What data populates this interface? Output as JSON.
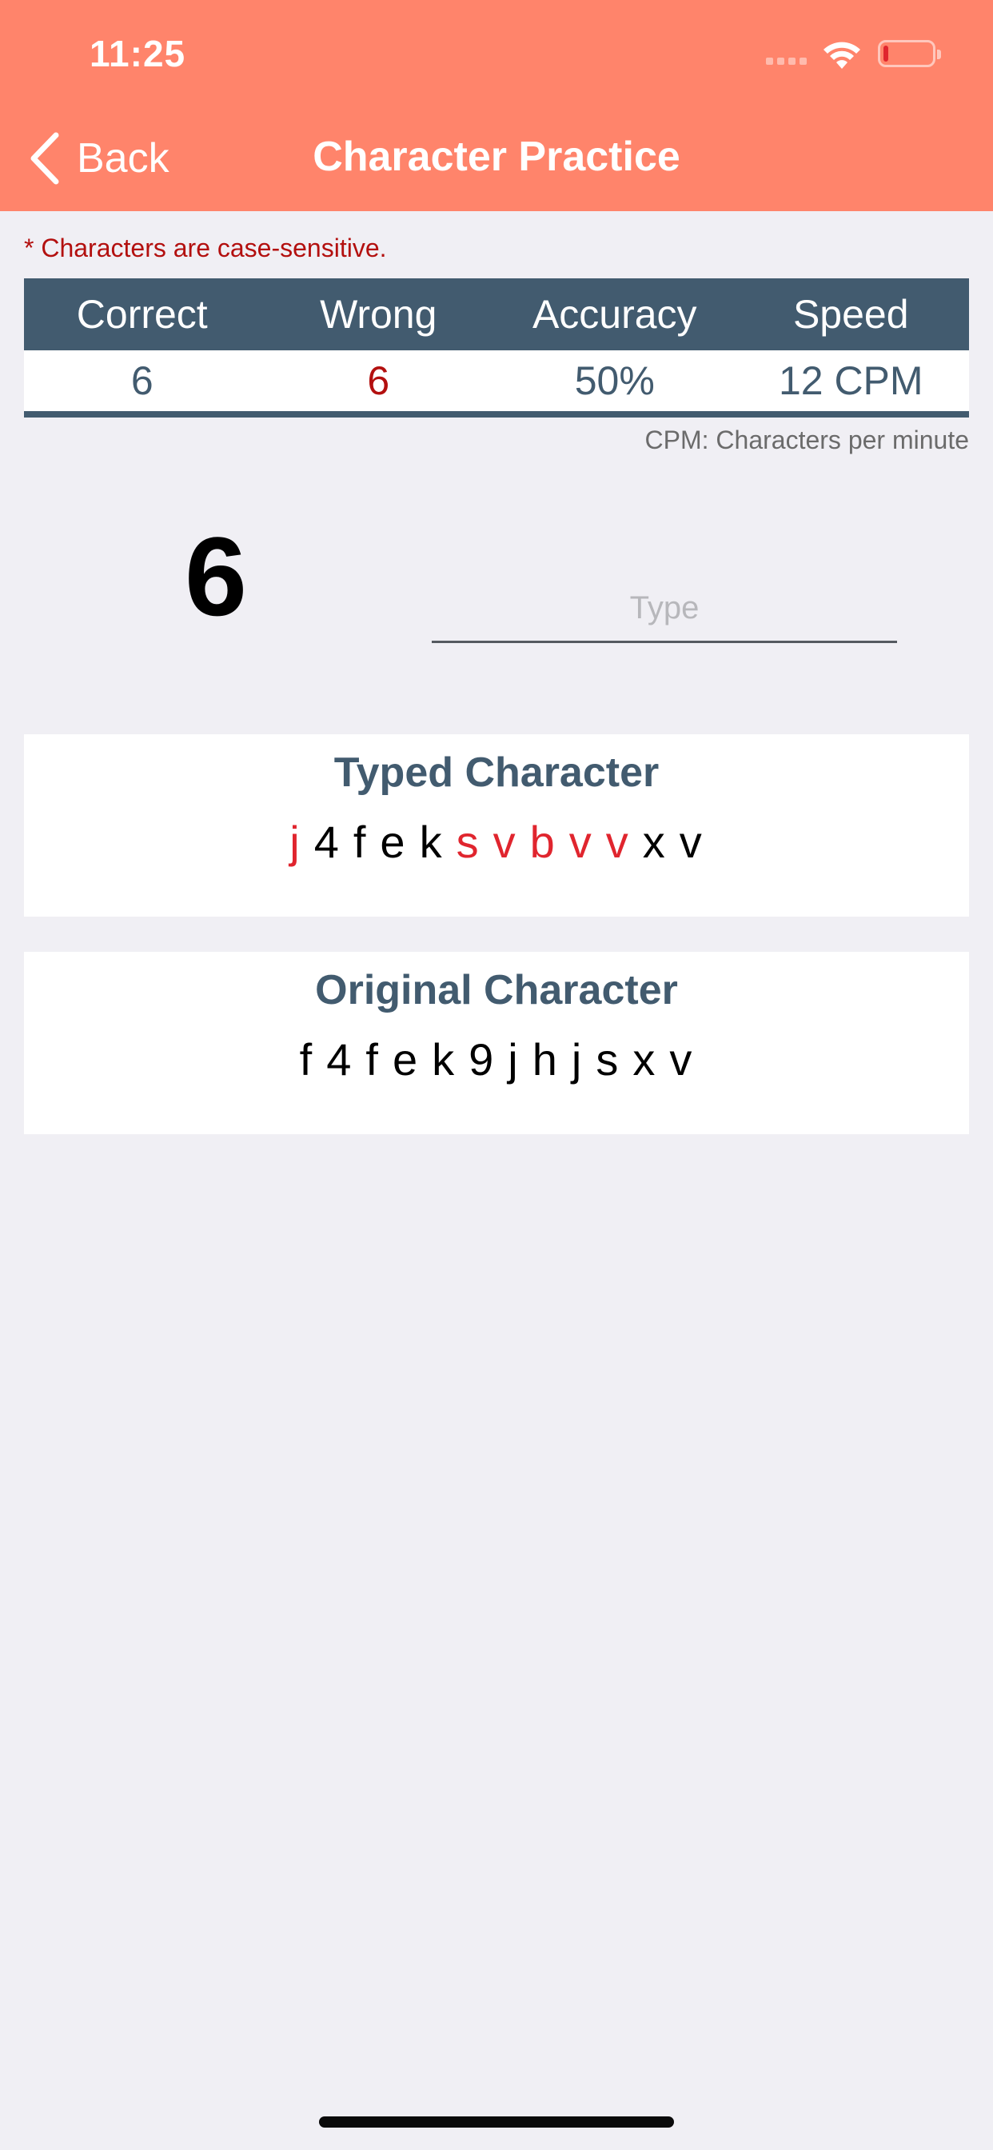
{
  "status_bar": {
    "time": "11:25"
  },
  "nav": {
    "back_label": "Back",
    "title": "Character Practice"
  },
  "notice": "* Characters are case-sensitive.",
  "stats": {
    "headers": [
      "Correct",
      "Wrong",
      "Accuracy",
      "Speed"
    ],
    "values": [
      "6",
      "6",
      "50%",
      "12 CPM"
    ]
  },
  "cpm_note": "CPM: Characters per minute",
  "current_character": "6",
  "input": {
    "placeholder": "Type",
    "value": ""
  },
  "typed": {
    "title": "Typed Character",
    "chars": [
      {
        "c": "j",
        "correct": false
      },
      {
        "c": "4",
        "correct": true
      },
      {
        "c": "f",
        "correct": true
      },
      {
        "c": "e",
        "correct": true
      },
      {
        "c": "k",
        "correct": true
      },
      {
        "c": "s",
        "correct": false
      },
      {
        "c": "v",
        "correct": false
      },
      {
        "c": "b",
        "correct": false
      },
      {
        "c": "v",
        "correct": false
      },
      {
        "c": "v",
        "correct": false
      },
      {
        "c": "x",
        "correct": true
      },
      {
        "c": "v",
        "correct": true
      }
    ]
  },
  "original": {
    "title": "Original Character",
    "chars": [
      "f",
      "4",
      "f",
      "e",
      "k",
      "9",
      "j",
      "h",
      "j",
      "s",
      "x",
      "v"
    ]
  },
  "colors": {
    "header_bg": "#ff846b",
    "table_head": "#425b6f",
    "error_red": "#e0252e",
    "note_red": "#b3100f"
  }
}
